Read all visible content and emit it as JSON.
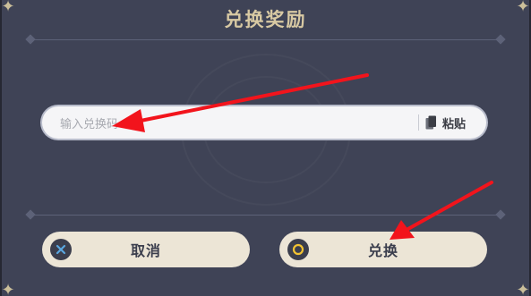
{
  "dialog": {
    "title": "兑换奖励"
  },
  "code_input": {
    "placeholder": "输入兑换码",
    "value": ""
  },
  "paste": {
    "label": "粘贴",
    "icon": "paste-icon"
  },
  "buttons": {
    "cancel_label": "取消",
    "cancel_icon": "cross-icon",
    "confirm_label": "兑换",
    "confirm_icon": "circle-icon"
  },
  "colors": {
    "panel": "#3f4356",
    "title_gold": "#d8c9a3",
    "button_bg": "#ece5d6",
    "annotation_arrow": "#f2141c"
  }
}
